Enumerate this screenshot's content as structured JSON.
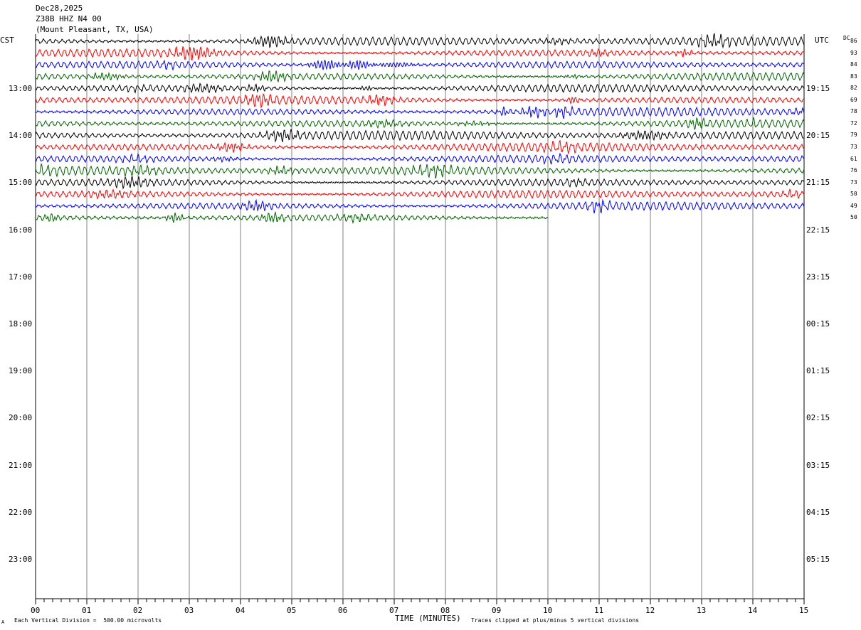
{
  "header": {
    "date": "Dec28,2025",
    "station": "Z38B HHZ N4 00",
    "location": "(Mount Pleasant, TX, USA)"
  },
  "axis": {
    "left_title": "CST",
    "right_title": "UTC",
    "dc_title": "DC",
    "xlabel": "TIME (MINUTES)",
    "bottom_left_note": "Each Vertical Division =  500.00 microvolts",
    "bottom_right_note": "Traces clipped at plus/minus 5 vertical divisions",
    "corner_mark": "A"
  },
  "chart_data": {
    "type": "line",
    "x_minutes_range": [
      0,
      15
    ],
    "x_ticks": [
      "00",
      "01",
      "02",
      "03",
      "04",
      "05",
      "06",
      "07",
      "08",
      "09",
      "10",
      "11",
      "12",
      "13",
      "14",
      "15"
    ],
    "hour_labels_cst": [
      "13:00",
      "14:00",
      "15:00",
      "16:00",
      "17:00",
      "18:00",
      "19:00",
      "20:00",
      "21:00",
      "22:00",
      "23:00"
    ],
    "hour_labels_utc": [
      "19:15",
      "20:15",
      "21:15",
      "22:15",
      "23:15",
      "00:15",
      "01:15",
      "02:15",
      "03:15",
      "04:15",
      "05:15"
    ],
    "trace_colors": [
      "#000000",
      "#ff0000",
      "#0000ff",
      "#006400"
    ],
    "dc_offsets": [
      "86",
      "93",
      "84",
      "83",
      "82",
      "69",
      "78",
      "72",
      "79",
      "73",
      "61",
      "76",
      "73",
      "50",
      "49",
      "50"
    ],
    "trace_end_minutes": [
      15,
      15,
      15,
      15,
      15,
      15,
      15,
      15,
      15,
      15,
      15,
      15,
      15,
      15,
      15,
      10
    ],
    "grid": true,
    "traces_per_hour": 4
  }
}
